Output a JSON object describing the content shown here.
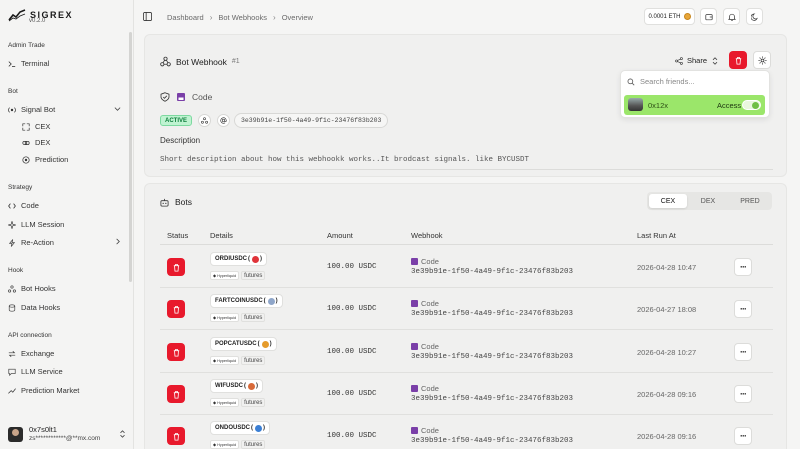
{
  "brand": {
    "name": "SIGREX",
    "version": "v0.2.0"
  },
  "sidebar": {
    "groups": [
      {
        "label": "Admin Trade"
      },
      {
        "label": "Bot"
      },
      {
        "label": "Strategy"
      },
      {
        "label": "Hook"
      },
      {
        "label": "API connection"
      }
    ],
    "items": {
      "terminal": "Terminal",
      "signal_bot": "Signal Bot",
      "cex": "CEX",
      "dex": "DEX",
      "prediction": "Prediction",
      "code": "Code",
      "llm_session": "LLM Session",
      "re_action": "Re-Action",
      "bot_hooks": "Bot Hooks",
      "data_hooks": "Data Hooks",
      "exchange": "Exchange",
      "llm_service": "LLM Service",
      "prediction_market": "Prediction Market"
    },
    "user": {
      "name": "0x7s0lt1",
      "email": "zs************@**mx.com"
    }
  },
  "topbar": {
    "breadcrumbs": [
      "Dashboard",
      "Bot Webhooks",
      "Overview"
    ],
    "balance": "0.0001 ETH"
  },
  "webhook": {
    "title": "Bot Webhook",
    "number": "#1",
    "share_label": "Share",
    "code_label": "Code",
    "status": "ACTIVE",
    "id": "3e39b91e-1f50-4a49-9f1c-23476f83b203",
    "description_label": "Description",
    "description": "Short description about how this webhookk works..It brodcast signals. like BYCUSDT"
  },
  "share_dropdown": {
    "search_placeholder": "Search friends...",
    "friend": {
      "name": "0x12x",
      "access_label": "Access",
      "access": true
    }
  },
  "bots": {
    "title": "Bots",
    "tabs": [
      "CEX",
      "DEX",
      "PRED"
    ],
    "active_tab": "CEX",
    "columns": [
      "Status",
      "Details",
      "Amount",
      "Webhook",
      "Last Run At"
    ],
    "rows": [
      {
        "symbol": "ORDIUSDC",
        "emoji_color": "#e0343a",
        "exchange_tag": "Hyperliquid",
        "type": "futures",
        "amount": "100.00 USDC",
        "webhook_label": "Code",
        "webhook_id": "3e39b91e-1f50-4a49-9f1c-23476f83b203",
        "last_run": "2026-04-28 10:47"
      },
      {
        "symbol": "FARTCOINUSDC",
        "emoji_color": "#8fa6c9",
        "exchange_tag": "Hyperliquid",
        "type": "futures",
        "amount": "100.00 USDC",
        "webhook_label": "Code",
        "webhook_id": "3e39b91e-1f50-4a49-9f1c-23476f83b203",
        "last_run": "2026-04-27 18:08"
      },
      {
        "symbol": "POPCATUSDC",
        "emoji_color": "#e59b2b",
        "exchange_tag": "Hyperliquid",
        "type": "futures",
        "amount": "100.00 USDC",
        "webhook_label": "Code",
        "webhook_id": "3e39b91e-1f50-4a49-9f1c-23476f83b203",
        "last_run": "2026-04-28 10:27"
      },
      {
        "symbol": "WIFUSDC",
        "emoji_color": "#d86a3a",
        "exchange_tag": "Hyperliquid",
        "type": "futures",
        "amount": "100.00 USDC",
        "webhook_label": "Code",
        "webhook_id": "3e39b91e-1f50-4a49-9f1c-23476f83b203",
        "last_run": "2026-04-28 09:16"
      },
      {
        "symbol": "ONDOUSDC",
        "emoji_color": "#3b7fd4",
        "exchange_tag": "Hyperliquid",
        "type": "futures",
        "amount": "100.00 USDC",
        "webhook_label": "Code",
        "webhook_id": "3e39b91e-1f50-4a49-9f1c-23476f83b203",
        "last_run": "2026-04-28 09:16"
      }
    ]
  },
  "colors": {
    "danger": "#e8192c",
    "active_green": "#0d7d3c",
    "friend_highlight": "#9be66a"
  }
}
